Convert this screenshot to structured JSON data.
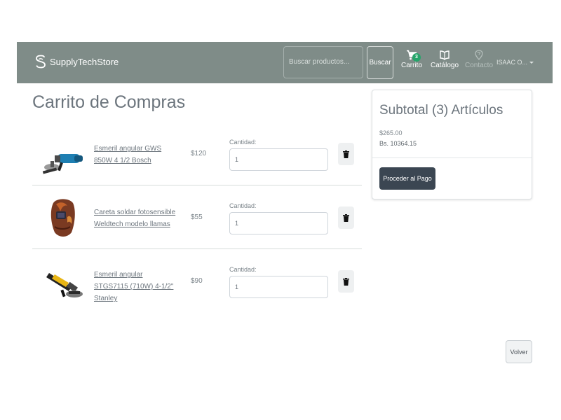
{
  "navbar": {
    "brand": "SupplyTechStore",
    "search_placeholder": "Buscar productos...",
    "search_button": "Buscar",
    "cart_label": "Carrito",
    "cart_count": "3",
    "catalog_label": "Catálogo",
    "contact_label": "Contacto",
    "user_label": "ISAAC O...",
    "icons": {
      "brand": "dollar-s-logo-icon",
      "cart": "shopping-cart-icon",
      "catalog": "book-open-icon",
      "contact": "map-pin-icon",
      "dropdown": "caret-down-icon"
    }
  },
  "page": {
    "title": "Carrito de Compras"
  },
  "cart_items": [
    {
      "name": "Esmeril angular GWS 850W 4 1/2 Bosch",
      "price": "$120",
      "quantity_label": "Cantidad:",
      "quantity": "1",
      "image": "angle-grinder-blue"
    },
    {
      "name": "Careta soldar fotosensible Weldtech modelo llamas",
      "price": "$55",
      "quantity_label": "Cantidad:",
      "quantity": "1",
      "image": "welding-helmet-flames"
    },
    {
      "name": "Esmeril angular STGS7115 (710W) 4-1/2\" Stanley",
      "price": "$90",
      "quantity_label": "Cantidad:",
      "quantity": "1",
      "image": "angle-grinder-yellow"
    }
  ],
  "summary": {
    "title": "Subtotal (3) Artículos",
    "subtotal_usd": "$265.00",
    "subtotal_bs": "Bs. 10364.15",
    "checkout_button": "Proceder al Pago"
  },
  "back_button": "Volver",
  "colors": {
    "navbar": "#7f8c88",
    "badge": "#25a56a",
    "checkout": "#3b4652"
  }
}
